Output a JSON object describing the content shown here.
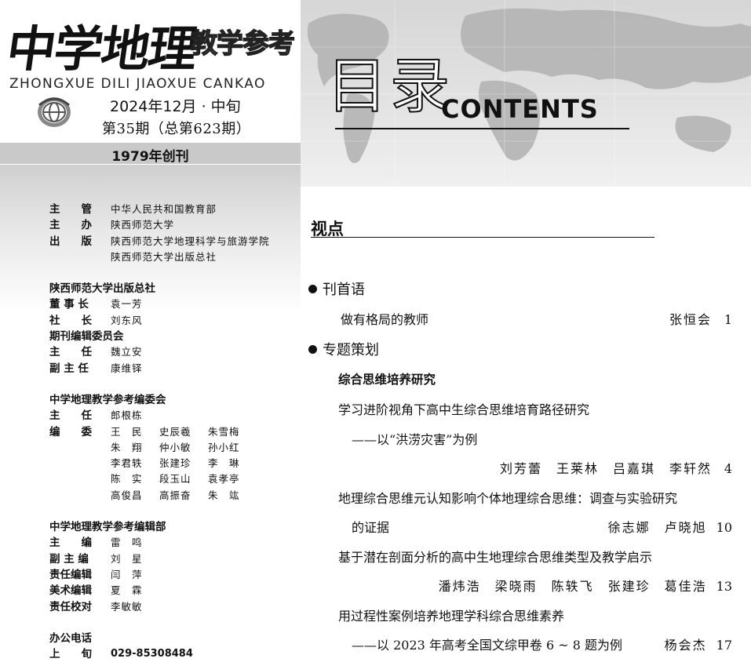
{
  "journal": {
    "title_cn": "中学地理",
    "subtitle_cn": "教学参考",
    "pinyin": "ZHONGXUE DILI JIAOXUE CANKAO",
    "issue_date": "2024年12月 · 中旬",
    "issue_number": "第35期（总第623期）",
    "founded": "1979年创刊"
  },
  "masthead": {
    "sponsors": [
      {
        "label": "主　　管",
        "value": "中华人民共和国教育部"
      },
      {
        "label": "主　　办",
        "value": "陕西师范大学"
      },
      {
        "label": "出　　版",
        "value": "陕西师范大学地理科学与旅游学院"
      },
      {
        "label": "",
        "value": "陕西师范大学出版总社"
      }
    ],
    "press_head": "陕西师范大学出版总社",
    "press": [
      {
        "label": "董 事 长",
        "value": "袁一芳"
      },
      {
        "label": "社　　长",
        "value": "刘东风"
      }
    ],
    "committee_head": "期刊编辑委员会",
    "committee": [
      {
        "label": "主　　任",
        "value": "魏立安"
      },
      {
        "label": "副 主 任",
        "value": "康维铎"
      }
    ],
    "board_head": "中学地理教学参考编委会",
    "board_director_label": "主　　任",
    "board_director": "郎根栋",
    "board_members_label": "编　　委",
    "board_members": [
      "王　民",
      "史辰羲",
      "朱雪梅",
      "朱　翔",
      "仲小敏",
      "孙小红",
      "李君轶",
      "张建珍",
      "李　琳",
      "陈　实",
      "段玉山",
      "袁孝亭",
      "高俊昌",
      "高振奋",
      "朱　竑"
    ],
    "dept_head": "中学地理教学参考编辑部",
    "dept": [
      {
        "label": "主　　编",
        "value": "雷　鸣"
      },
      {
        "label": "副 主 编",
        "value": "刘　星"
      },
      {
        "label": "责任编辑",
        "value": "闫　萍"
      },
      {
        "label": "美术编辑",
        "value": "夏　霖"
      },
      {
        "label": "责任校对",
        "value": "李敏敏"
      }
    ],
    "office_phone_head": "办公电话",
    "phone_label": "上　　旬",
    "phone_value": "029-85308484"
  },
  "header": {
    "title_cn": "目录",
    "title_en": "CONTENTS"
  },
  "toc": {
    "section": "视点",
    "column1": "刊首语",
    "item1": {
      "title": "做有格局的教师",
      "authors": "张恒会",
      "page": "1"
    },
    "column2": "专题策划",
    "topic": "综合思维培养研究",
    "item2": {
      "title": "学习进阶视角下高中生综合思维培育路径研究",
      "subtitle": "——以“洪涝灾害”为例",
      "authors": "刘芳蕾　王莱林　吕嘉琪　李轩然",
      "page": "4"
    },
    "item3": {
      "title": "地理综合思维元认知影响个体地理综合思维：调查与实验研究",
      "subtitle": "的证据",
      "authors": "徐志娜　卢晓旭",
      "page": "10"
    },
    "item4": {
      "title": "基于潜在剖面分析的高中生地理综合思维类型及教学启示",
      "authors": "潘炜浩　梁晓雨　陈轶飞　张建珍　葛佳浩",
      "page": "13"
    },
    "item5": {
      "title": "用过程性案例培养地理学科综合思维素养",
      "subtitle": "——以 2023 年高考全国文综甲卷 6 ~ 8 题为例",
      "authors": "杨会杰",
      "page": "17"
    }
  }
}
